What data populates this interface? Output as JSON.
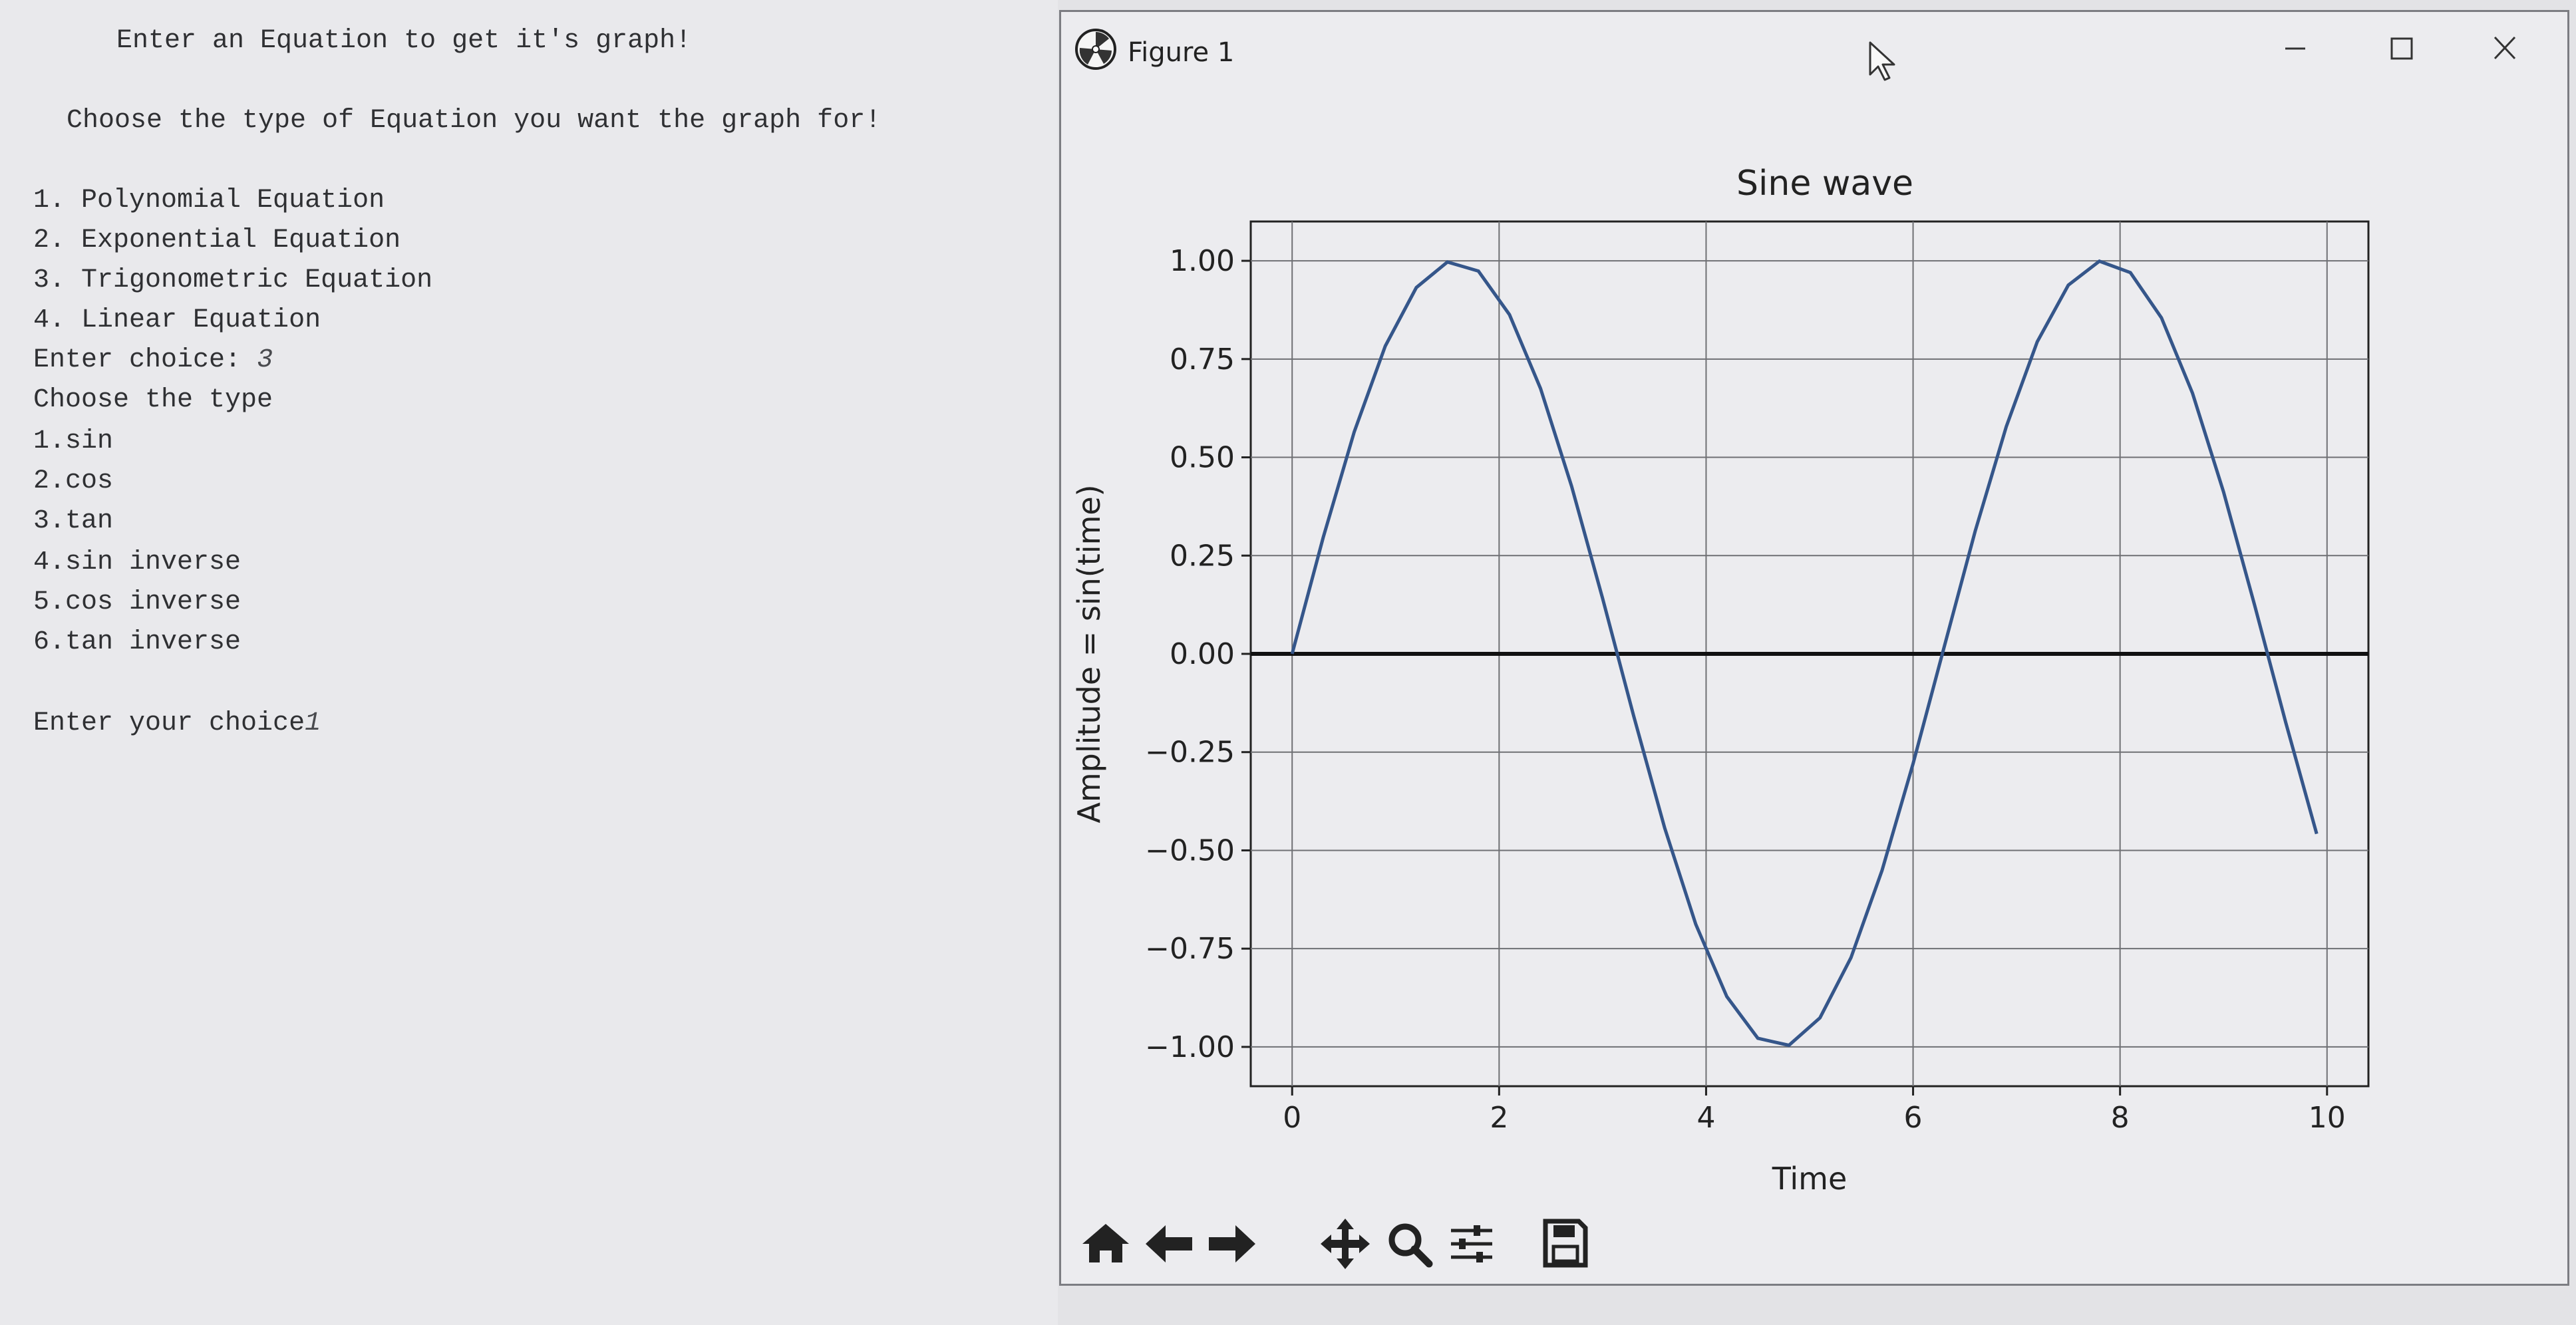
{
  "console": {
    "lines": [
      "Enter an Equation to get it's graph!",
      "Choose the type of Equation you want the graph for!",
      "1. Polynomial Equation",
      "2. Exponential Equation",
      "3. Trigonometric Equation",
      "4. Linear Equation",
      "Enter choice: ",
      "Choose the type",
      "1.sin",
      "2.cos",
      "3.tan",
      "4.sin inverse",
      "5.cos inverse",
      "6.tan inverse",
      "Enter your choice"
    ],
    "typed_choice_1": "3",
    "typed_choice_2": "1"
  },
  "window": {
    "title": "Figure 1",
    "controls": [
      "minimize",
      "maximize",
      "close"
    ],
    "icon": "matplotlib-icon"
  },
  "toolbar": {
    "buttons": [
      "home-icon",
      "back-arrow-icon",
      "forward-arrow-icon",
      "pan-icon",
      "zoom-icon",
      "configure-subplots-icon",
      "save-icon"
    ]
  },
  "chart_data": {
    "type": "line",
    "title": "Sine wave",
    "xlabel": "Time",
    "ylabel": "Amplitude = sin(time)",
    "xlim": [
      -0.4,
      10.4
    ],
    "ylim": [
      -1.1,
      1.1
    ],
    "xticks": [
      "0",
      "2",
      "4",
      "6",
      "8",
      "10"
    ],
    "xtick_values": [
      0,
      2,
      4,
      6,
      8,
      10
    ],
    "yticks": [
      "1.00",
      "0.75",
      "0.50",
      "0.25",
      "0.00",
      "−0.25",
      "−0.50",
      "−0.75",
      "−1.00"
    ],
    "ytick_values": [
      1.0,
      0.75,
      0.5,
      0.25,
      0.0,
      -0.25,
      -0.5,
      -0.75,
      -1.0
    ],
    "grid": true,
    "baseline_y": 0,
    "series": [
      {
        "x": [
          0,
          0.3,
          0.6,
          0.9,
          1.2,
          1.5,
          1.8,
          2.1,
          2.4,
          2.7,
          3.0,
          3.3,
          3.6,
          3.9,
          4.2,
          4.5,
          4.8,
          5.1,
          5.4,
          5.7,
          6.0,
          6.3,
          6.6,
          6.9,
          7.2,
          7.5,
          7.8,
          8.1,
          8.4,
          8.7,
          9.0,
          9.3,
          9.6,
          9.9
        ],
        "y": [
          0.0,
          0.296,
          0.565,
          0.783,
          0.932,
          0.997,
          0.974,
          0.863,
          0.675,
          0.427,
          0.141,
          -0.158,
          -0.443,
          -0.688,
          -0.872,
          -0.978,
          -0.996,
          -0.926,
          -0.773,
          -0.551,
          -0.279,
          0.017,
          0.312,
          0.578,
          0.794,
          0.938,
          0.999,
          0.97,
          0.855,
          0.663,
          0.412,
          0.124,
          -0.174,
          -0.458
        ],
        "color": "#35568a"
      }
    ]
  }
}
